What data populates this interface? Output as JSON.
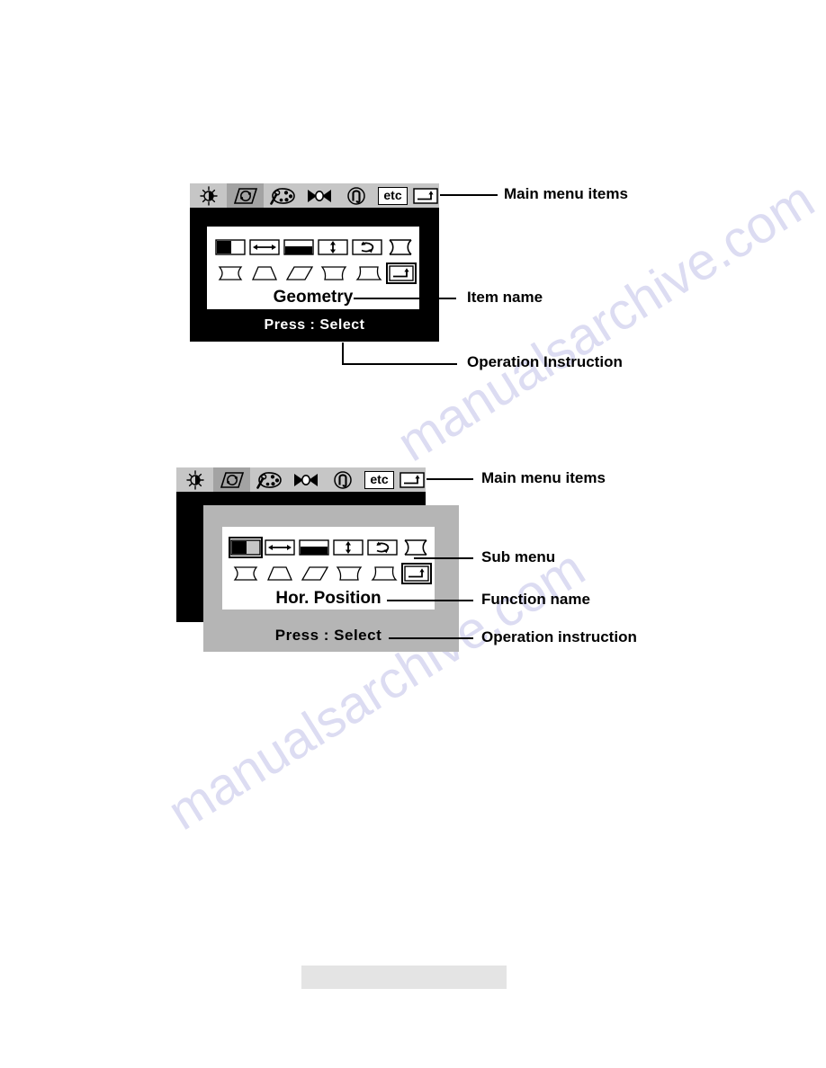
{
  "document": {
    "watermark_line1": "manualsarchive.com",
    "watermark_line2": "manualsarchive.com"
  },
  "panel_one": {
    "name": "osd-main-menu-geometry-highlighted",
    "item_name": "Geometry",
    "operation_instruction": "Press : Select",
    "main_menu_items": [
      {
        "id": "brightness-contrast",
        "label": "",
        "icon": "sun-contrast-icon",
        "selected": false
      },
      {
        "id": "geometry",
        "label": "",
        "icon": "geometry-parallelogram-icon",
        "selected": true
      },
      {
        "id": "color",
        "label": "",
        "icon": "color-palette-icon",
        "selected": false
      },
      {
        "id": "convergence",
        "label": "",
        "icon": "convergence-bowtie-icon",
        "selected": false
      },
      {
        "id": "degauss",
        "label": "",
        "icon": "degauss-horseshoe-icon",
        "selected": false
      },
      {
        "id": "etc",
        "label": "etc",
        "icon": "etc-text-icon",
        "selected": false
      },
      {
        "id": "exit",
        "label": "",
        "icon": "exit-return-icon",
        "selected": false
      }
    ],
    "sub_menu_row_one": [
      {
        "id": "hor-position",
        "icon": "hor-position-icon",
        "selected": false
      },
      {
        "id": "hor-size",
        "icon": "hor-size-arrow-icon",
        "selected": false
      },
      {
        "id": "ver-position",
        "icon": "ver-position-icon",
        "selected": false
      },
      {
        "id": "ver-size",
        "icon": "ver-size-arrow-icon",
        "selected": false
      },
      {
        "id": "rotation",
        "icon": "rotation-icon",
        "selected": false
      },
      {
        "id": "pincushion",
        "icon": "pincushion-icon",
        "selected": false
      }
    ],
    "sub_menu_row_two": [
      {
        "id": "pin-balance",
        "icon": "pin-balance-icon",
        "selected": false
      },
      {
        "id": "trapezoid",
        "icon": "trapezoid-icon",
        "selected": false
      },
      {
        "id": "parallelogram",
        "icon": "parallelogram-icon",
        "selected": false
      },
      {
        "id": "top-corner",
        "icon": "top-corner-icon",
        "selected": false
      },
      {
        "id": "bottom-corner",
        "icon": "bottom-corner-icon",
        "selected": false
      },
      {
        "id": "exit",
        "icon": "exit-return-icon",
        "selected": false
      }
    ],
    "annotations": {
      "main_menu_items": "Main menu items",
      "item_name": "Item name",
      "operation_instruction": "Operation Instruction"
    }
  },
  "panel_two": {
    "name": "osd-sub-menu-hor-position-highlighted",
    "function_name": "Hor. Position",
    "operation_instruction": "Press : Select",
    "main_menu_items": [
      {
        "id": "brightness-contrast",
        "label": "",
        "icon": "sun-contrast-icon",
        "selected": false
      },
      {
        "id": "geometry",
        "label": "",
        "icon": "geometry-parallelogram-icon",
        "selected": true
      },
      {
        "id": "color",
        "label": "",
        "icon": "color-palette-icon",
        "selected": false
      },
      {
        "id": "convergence",
        "label": "",
        "icon": "convergence-bowtie-icon",
        "selected": false
      },
      {
        "id": "degauss",
        "label": "",
        "icon": "degauss-horseshoe-icon",
        "selected": false
      },
      {
        "id": "etc",
        "label": "etc",
        "icon": "etc-text-icon",
        "selected": false
      },
      {
        "id": "exit",
        "label": "",
        "icon": "exit-return-icon",
        "selected": false
      }
    ],
    "sub_menu_row_one": [
      {
        "id": "hor-position",
        "icon": "hor-position-icon",
        "selected": true
      },
      {
        "id": "hor-size",
        "icon": "hor-size-arrow-icon",
        "selected": false
      },
      {
        "id": "ver-position",
        "icon": "ver-position-icon",
        "selected": false
      },
      {
        "id": "ver-size",
        "icon": "ver-size-arrow-icon",
        "selected": false
      },
      {
        "id": "rotation",
        "icon": "rotation-icon",
        "selected": false
      },
      {
        "id": "pincushion",
        "icon": "pincushion-icon",
        "selected": false
      }
    ],
    "sub_menu_row_two": [
      {
        "id": "pin-balance",
        "icon": "pin-balance-icon",
        "selected": false
      },
      {
        "id": "trapezoid",
        "icon": "trapezoid-icon",
        "selected": false
      },
      {
        "id": "parallelogram",
        "icon": "parallelogram-icon",
        "selected": false
      },
      {
        "id": "top-corner",
        "icon": "top-corner-icon",
        "selected": false
      },
      {
        "id": "bottom-corner",
        "icon": "bottom-corner-icon",
        "selected": false
      },
      {
        "id": "exit",
        "icon": "exit-return-icon",
        "selected": false
      }
    ],
    "annotations": {
      "main_menu_items": "Main menu items",
      "sub_menu": "Sub menu",
      "function_name": "Function name",
      "operation_instruction": "Operation instruction"
    }
  },
  "colors": {
    "menubar_bg": "#c6c6c6",
    "menubar_selected": "#a3a3a3",
    "osd_black": "#000000",
    "osd_white": "#ffffff",
    "osd_gray": "#b5b5b5",
    "watermark": "#dcdcf2",
    "bottom_bar": "#e4e4e4"
  }
}
